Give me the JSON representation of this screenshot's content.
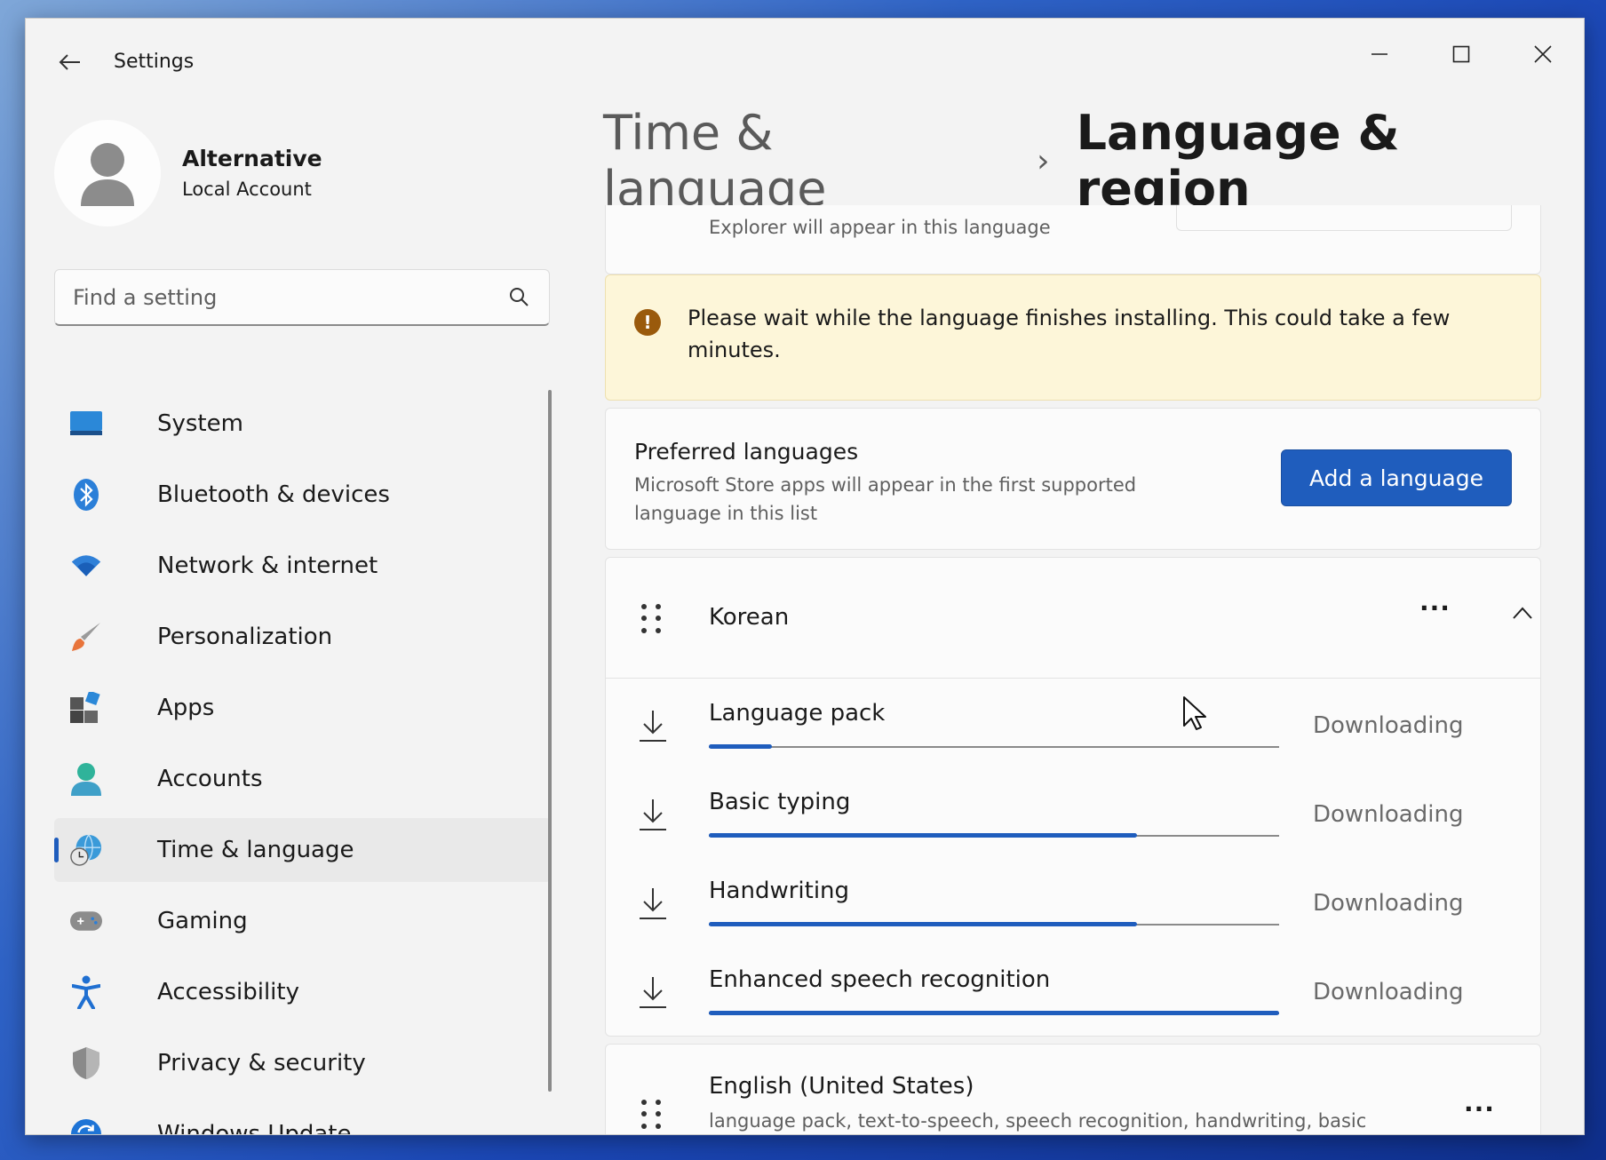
{
  "window": {
    "app_title": "Settings"
  },
  "profile": {
    "name": "Alternative",
    "account_type": "Local Account"
  },
  "search": {
    "placeholder": "Find a setting"
  },
  "sidebar": {
    "items": [
      {
        "label": "System",
        "icon": "system-icon"
      },
      {
        "label": "Bluetooth & devices",
        "icon": "bluetooth-icon"
      },
      {
        "label": "Network & internet",
        "icon": "wifi-icon"
      },
      {
        "label": "Personalization",
        "icon": "brush-icon"
      },
      {
        "label": "Apps",
        "icon": "apps-icon"
      },
      {
        "label": "Accounts",
        "icon": "accounts-icon"
      },
      {
        "label": "Time & language",
        "icon": "globe-clock-icon",
        "active": true
      },
      {
        "label": "Gaming",
        "icon": "gamepad-icon"
      },
      {
        "label": "Accessibility",
        "icon": "accessibility-icon"
      },
      {
        "label": "Privacy & security",
        "icon": "shield-icon"
      },
      {
        "label": "Windows Update",
        "icon": "update-icon"
      }
    ]
  },
  "header": {
    "parent": "Time & language",
    "separator": "›",
    "current": "Language & region"
  },
  "display_language": {
    "description": "Explorer will appear in this language"
  },
  "warning": {
    "text": "Please wait while the language finishes installing. This could take a few minutes."
  },
  "preferred": {
    "title": "Preferred languages",
    "description": "Microsoft Store apps will appear in the first supported language in this list",
    "add_button": "Add a language"
  },
  "languages": [
    {
      "name": "Korean",
      "more": "···",
      "downloads": [
        {
          "label": "Language pack",
          "status": "Downloading",
          "progress": 0.11
        },
        {
          "label": "Basic typing",
          "status": "Downloading",
          "progress": 0.75
        },
        {
          "label": "Handwriting",
          "status": "Downloading",
          "progress": 0.75
        },
        {
          "label": "Enhanced speech recognition",
          "status": "Downloading",
          "progress": 1.0
        }
      ]
    },
    {
      "name": "English (United States)",
      "features": "language pack, text-to-speech, speech recognition, handwriting, basic typing",
      "more": "···"
    }
  ],
  "colors": {
    "accent": "#1f5dbd",
    "warning_bg": "#fdf6d9",
    "warning_icon": "#9a5a0c"
  }
}
